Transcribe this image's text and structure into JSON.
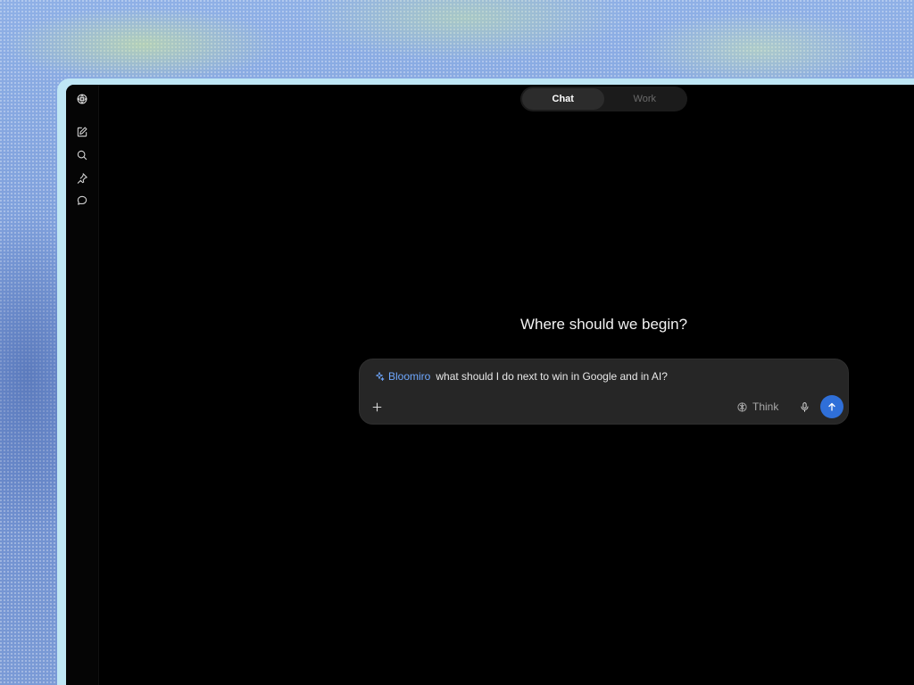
{
  "mode_toggle": {
    "options": [
      {
        "label": "Chat",
        "active": true
      },
      {
        "label": "Work",
        "active": false
      }
    ]
  },
  "sidebar": {
    "icons": [
      "logo-icon",
      "new-chat-icon",
      "search-icon",
      "pin-icon",
      "chat-bubble-icon"
    ]
  },
  "main": {
    "heading": "Where should we begin?"
  },
  "composer": {
    "chip_label": "Bloomiro",
    "prompt_text": "what should I do next to win in Google and in AI?",
    "think_label": "Think"
  },
  "colors": {
    "accent_blue": "#2f6fd8",
    "chip_text": "#6fa8ff",
    "window_bg": "#000000",
    "composer_bg": "#262626"
  }
}
